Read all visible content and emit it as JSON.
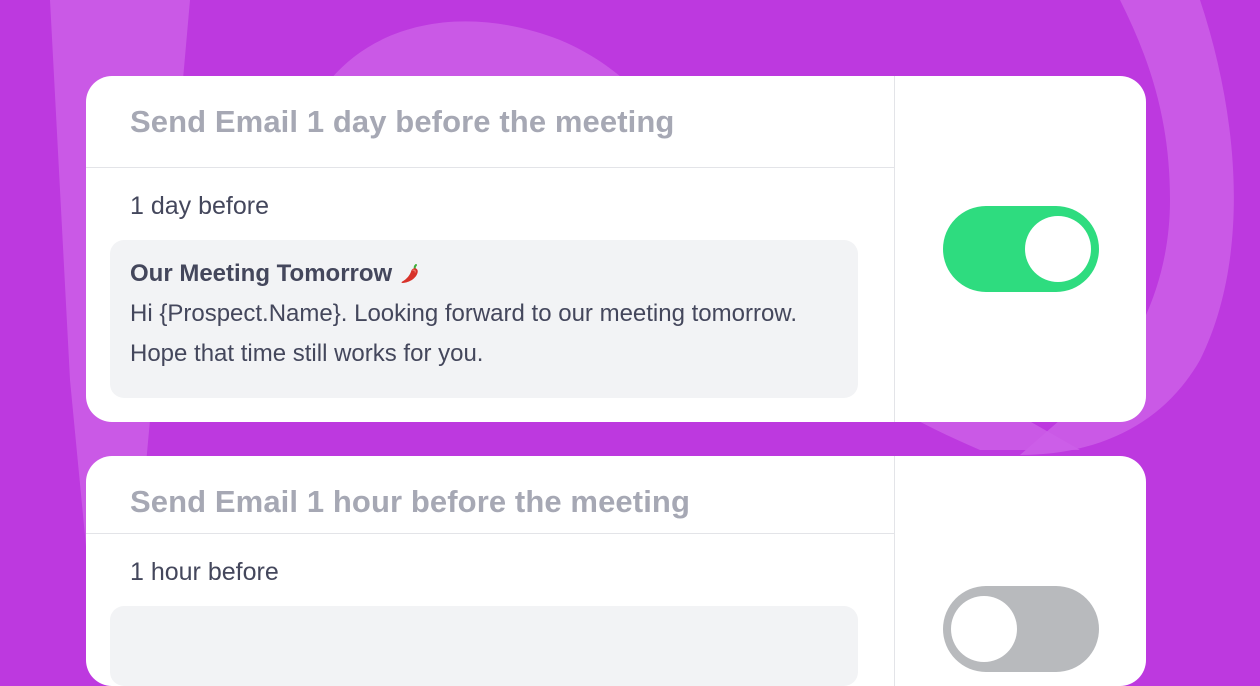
{
  "colors": {
    "background": "#bd39df",
    "swirl": "#d069ea",
    "toggle_on": "#2edc7f",
    "toggle_off": "#b8babd",
    "title_text": "#a6a8b4",
    "body_text": "#44475c"
  },
  "reminders": [
    {
      "title": "Send Email 1 day before the meeting",
      "timing": "1 day before",
      "subject": "Our Meeting Tomorrow",
      "subject_icon": "chili-pepper-icon",
      "body": "Hi {Prospect.Name}. Looking forward to our meeting tomorrow. Hope that time still works for you.",
      "enabled": true
    },
    {
      "title": "Send Email 1 hour before the meeting",
      "timing": "1 hour before",
      "enabled": false
    }
  ]
}
